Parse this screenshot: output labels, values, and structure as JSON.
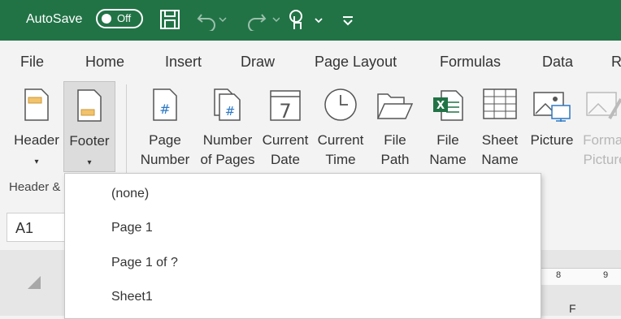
{
  "titlebar": {
    "autosave_label": "AutoSave",
    "autosave_state": "Off",
    "accent": "#217346",
    "icons": [
      "save-icon",
      "undo-icon",
      "redo-icon",
      "touch-mode-icon",
      "customize-qat-icon"
    ]
  },
  "tabs": [
    "File",
    "Home",
    "Insert",
    "Draw",
    "Page Layout",
    "Formulas",
    "Data",
    "R"
  ],
  "ribbon": {
    "header_label": "Header",
    "footer_label": "Footer",
    "page_number": [
      "Page",
      "Number"
    ],
    "number_of_pages": [
      "Number",
      "of Pages"
    ],
    "current_date": [
      "Current",
      "Date"
    ],
    "current_time": [
      "Current",
      "Time"
    ],
    "file_path": [
      "File",
      "Path"
    ],
    "file_name": [
      "File",
      "Name"
    ],
    "sheet_name": [
      "Sheet",
      "Name"
    ],
    "picture": "Picture",
    "format_picture": [
      "Format",
      "Picture"
    ],
    "group_label": "Header &"
  },
  "namebox": "A1",
  "ruler": [
    "8",
    "9"
  ],
  "column_label": "F",
  "dropdown": {
    "items": [
      "(none)",
      "Page 1",
      "Page 1 of ?",
      "Sheet1"
    ]
  }
}
